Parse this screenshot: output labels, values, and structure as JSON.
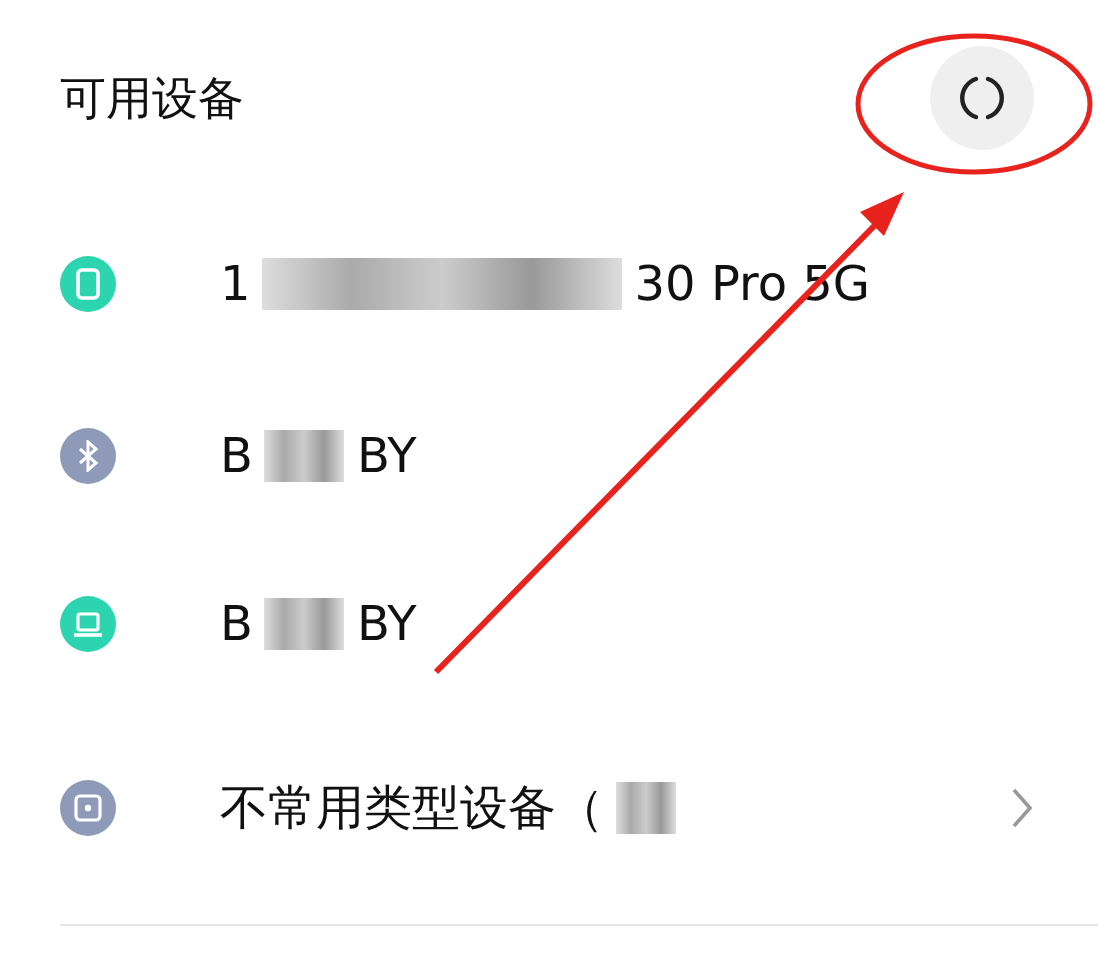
{
  "header": {
    "title": "可用设备"
  },
  "devices": [
    {
      "kind": "phone",
      "name_start": "1",
      "name_end": "30 Pro 5G",
      "chevron": false
    },
    {
      "kind": "bluetooth",
      "name_start": "B",
      "name_end": "BY",
      "chevron": false
    },
    {
      "kind": "laptop",
      "name_start": "B",
      "name_end": "BY",
      "chevron": false
    },
    {
      "kind": "other",
      "name_start": "不常用类型设备（",
      "chevron": true
    }
  ]
}
